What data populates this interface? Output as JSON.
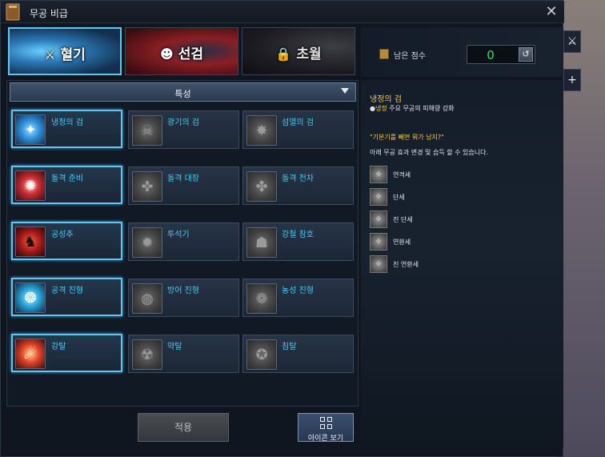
{
  "window": {
    "title": "무공 비급"
  },
  "tabs": [
    {
      "label": "혈기",
      "icon": "blade-icon"
    },
    {
      "label": "선검",
      "icon": "mask-icon"
    },
    {
      "label": "초월",
      "icon": "lock-icon"
    }
  ],
  "score": {
    "label": "남은 점수",
    "value": "0"
  },
  "side_buttons": [
    "blade-icon",
    "plus-icon"
  ],
  "side_plus": "+",
  "dropdown": {
    "label": "특성"
  },
  "skills": [
    {
      "name": "냉정의 검",
      "active": true
    },
    {
      "name": "광기의 검",
      "active": false
    },
    {
      "name": "섬멸의 검",
      "active": false
    },
    {
      "name": "돌격 준비",
      "active": true
    },
    {
      "name": "돌격 대장",
      "active": false
    },
    {
      "name": "돌격 전차",
      "active": false
    },
    {
      "name": "공성추",
      "active": true
    },
    {
      "name": "투석기",
      "active": false
    },
    {
      "name": "강철 참호",
      "active": false
    },
    {
      "name": "공격 진형",
      "active": true
    },
    {
      "name": "방어 진형",
      "active": false
    },
    {
      "name": "농성 진형",
      "active": false
    },
    {
      "name": "강탈",
      "active": true
    },
    {
      "name": "약탈",
      "active": false
    },
    {
      "name": "침탈",
      "active": false
    }
  ],
  "buttons": {
    "apply": "적용",
    "icon_view": "아이콘 보기"
  },
  "info": {
    "title": "냉정의 검",
    "desc_bullet": "●",
    "desc_keyword": "냉정",
    "desc_text": " 주요 무공의 피해량 강화",
    "quote": "\"기본기를 빼면 뭐가 남지?\"",
    "note": "아래 무공 효과 변경 및 습득 할 수 있습니다.",
    "sub_skills": [
      "연격세",
      "단세",
      "진 단세",
      "연환세",
      "진 연환세"
    ]
  }
}
